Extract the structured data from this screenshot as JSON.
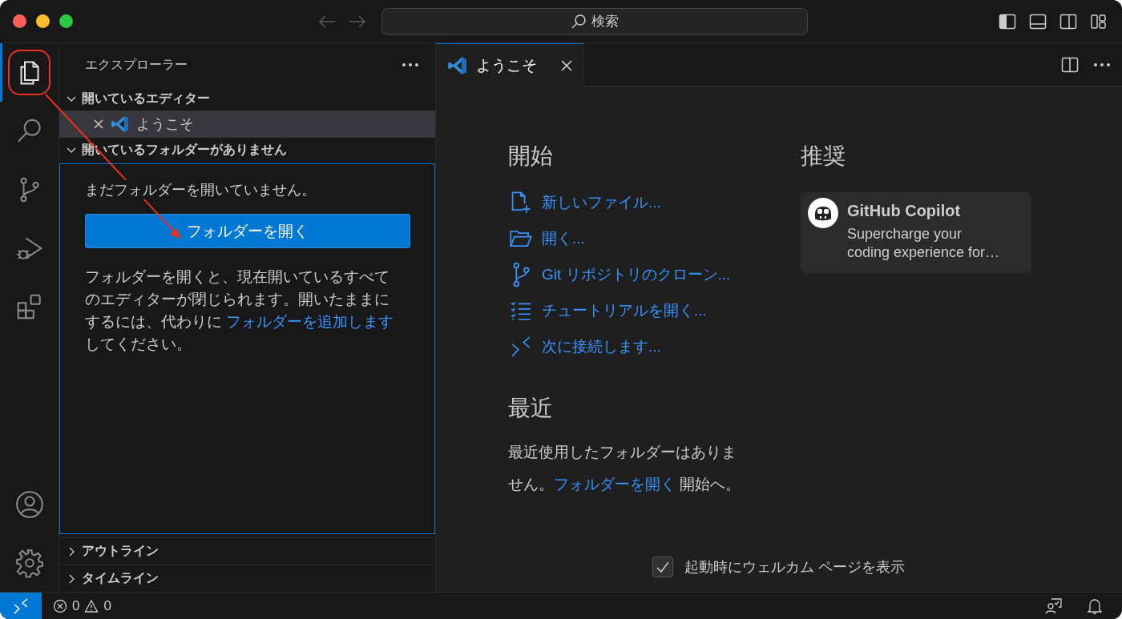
{
  "titlebar": {
    "search_placeholder": "検索"
  },
  "activity_bar": {
    "items": [
      {
        "kind": "explorer",
        "selected": true
      },
      {
        "kind": "search",
        "selected": false
      },
      {
        "kind": "scm",
        "selected": false
      },
      {
        "kind": "debug",
        "selected": false
      },
      {
        "kind": "extensions",
        "selected": false
      }
    ],
    "bottom_items": [
      {
        "kind": "account"
      },
      {
        "kind": "settings"
      }
    ]
  },
  "sidebar": {
    "title": "エクスプローラー",
    "sections": [
      {
        "kind": "editors",
        "label": "開いているエディター",
        "expanded": true,
        "items": [
          {
            "label": "ようこそ",
            "selected": true
          }
        ]
      },
      {
        "kind": "folder",
        "label": "開いているフォルダーがありません",
        "expanded": true,
        "message": "まだフォルダーを開いていません。",
        "button": "フォルダーを開く",
        "note_before": "フォルダーを開くと、現在開いているすべてのエディターが閉じられます。開いたままにするには、代わりに ",
        "note_link": "フォルダーを追加します",
        "note_after": "してください。"
      },
      {
        "kind": "collapsed",
        "label": "アウトライン",
        "expanded": false
      },
      {
        "kind": "collapsed",
        "label": "タイムライン",
        "expanded": false
      }
    ]
  },
  "editor": {
    "tabs": [
      {
        "label": "ようこそ",
        "selected": true
      }
    ],
    "welcome": {
      "start": {
        "heading": "開始",
        "items": [
          {
            "kind": "new-file",
            "label": "新しいファイル..."
          },
          {
            "kind": "open",
            "label": "開く..."
          },
          {
            "kind": "clone",
            "label": "Git リポジトリのクローン..."
          },
          {
            "kind": "tutorial",
            "label": "チュートリアルを開く..."
          },
          {
            "kind": "connect",
            "label": "次に接続します..."
          }
        ]
      },
      "recent": {
        "heading": "最近",
        "text_before": "最近使用したフォルダーはありません。",
        "link": "フォルダーを開く",
        "text_after": " 開始へ。"
      },
      "recommended": {
        "heading": "推奨",
        "cards": [
          {
            "title": "GitHub Copilot",
            "description": "Supercharge your coding experience for…"
          }
        ]
      },
      "show_on_startup": {
        "label": "起動時にウェルカム ページを表示",
        "checked": true
      }
    }
  },
  "status_bar": {
    "errors": "0",
    "warnings": "0"
  }
}
